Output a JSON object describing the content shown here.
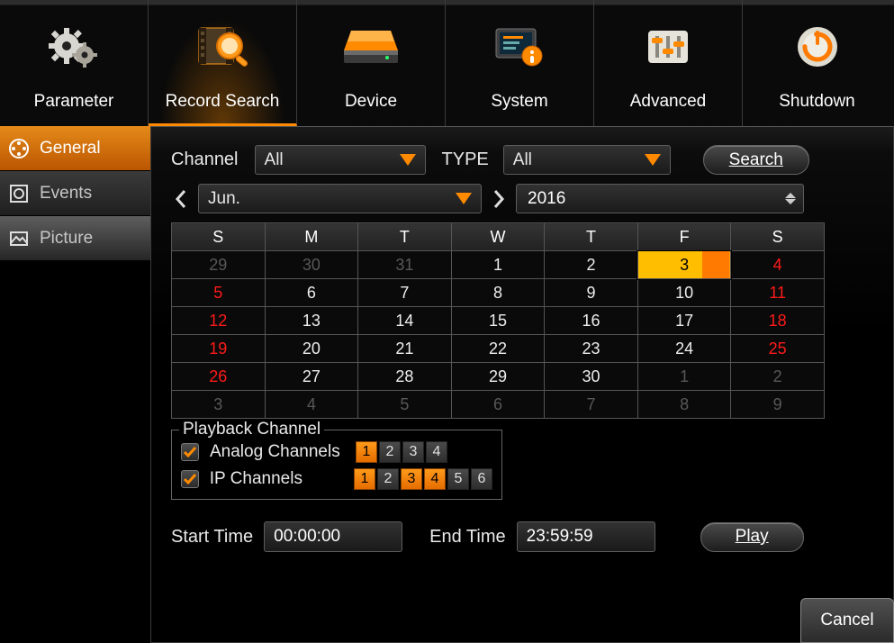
{
  "topnav": {
    "parameter": "Parameter",
    "record_search": "Record Search",
    "device": "Device",
    "system": "System",
    "advanced": "Advanced",
    "shutdown": "Shutdown"
  },
  "sidebar": {
    "general": "General",
    "events": "Events",
    "picture": "Picture"
  },
  "filters": {
    "channel_label": "Channel",
    "channel_value": "All",
    "type_label": "TYPE",
    "type_value": "All",
    "search_btn": "Search"
  },
  "calendar": {
    "month": "Jun.",
    "year": "2016",
    "dow": [
      "S",
      "M",
      "T",
      "W",
      "T",
      "F",
      "S"
    ],
    "weeks": [
      [
        {
          "d": "29",
          "cls": "out"
        },
        {
          "d": "30",
          "cls": "out"
        },
        {
          "d": "31",
          "cls": "out"
        },
        {
          "d": "1",
          "cls": ""
        },
        {
          "d": "2",
          "cls": ""
        },
        {
          "d": "3",
          "cls": "selected"
        },
        {
          "d": "4",
          "cls": "sun"
        }
      ],
      [
        {
          "d": "5",
          "cls": "sun"
        },
        {
          "d": "6",
          "cls": ""
        },
        {
          "d": "7",
          "cls": ""
        },
        {
          "d": "8",
          "cls": ""
        },
        {
          "d": "9",
          "cls": ""
        },
        {
          "d": "10",
          "cls": ""
        },
        {
          "d": "11",
          "cls": "sun"
        }
      ],
      [
        {
          "d": "12",
          "cls": "sun"
        },
        {
          "d": "13",
          "cls": ""
        },
        {
          "d": "14",
          "cls": ""
        },
        {
          "d": "15",
          "cls": ""
        },
        {
          "d": "16",
          "cls": ""
        },
        {
          "d": "17",
          "cls": ""
        },
        {
          "d": "18",
          "cls": "sun"
        }
      ],
      [
        {
          "d": "19",
          "cls": "sun"
        },
        {
          "d": "20",
          "cls": ""
        },
        {
          "d": "21",
          "cls": ""
        },
        {
          "d": "22",
          "cls": ""
        },
        {
          "d": "23",
          "cls": ""
        },
        {
          "d": "24",
          "cls": ""
        },
        {
          "d": "25",
          "cls": "sun"
        }
      ],
      [
        {
          "d": "26",
          "cls": "sun"
        },
        {
          "d": "27",
          "cls": ""
        },
        {
          "d": "28",
          "cls": ""
        },
        {
          "d": "29",
          "cls": ""
        },
        {
          "d": "30",
          "cls": ""
        },
        {
          "d": "1",
          "cls": "out"
        },
        {
          "d": "2",
          "cls": "out"
        }
      ],
      [
        {
          "d": "3",
          "cls": "out"
        },
        {
          "d": "4",
          "cls": "out"
        },
        {
          "d": "5",
          "cls": "out"
        },
        {
          "d": "6",
          "cls": "out"
        },
        {
          "d": "7",
          "cls": "out"
        },
        {
          "d": "8",
          "cls": "out"
        },
        {
          "d": "9",
          "cls": "out"
        }
      ]
    ]
  },
  "playback": {
    "title": "Playback Channel",
    "analog_label": "Analog Channels",
    "ip_label": "IP Channels",
    "analog": [
      {
        "n": "1",
        "on": true
      },
      {
        "n": "2",
        "on": false
      },
      {
        "n": "3",
        "on": false
      },
      {
        "n": "4",
        "on": false
      }
    ],
    "ip": [
      {
        "n": "1",
        "on": true
      },
      {
        "n": "2",
        "on": false
      },
      {
        "n": "3",
        "on": true
      },
      {
        "n": "4",
        "on": true
      },
      {
        "n": "5",
        "on": false
      },
      {
        "n": "6",
        "on": false
      }
    ]
  },
  "time": {
    "start_label": "Start Time",
    "start_value": "00:00:00",
    "end_label": "End Time",
    "end_value": "23:59:59",
    "play_btn": "Play"
  },
  "cancel": "Cancel"
}
